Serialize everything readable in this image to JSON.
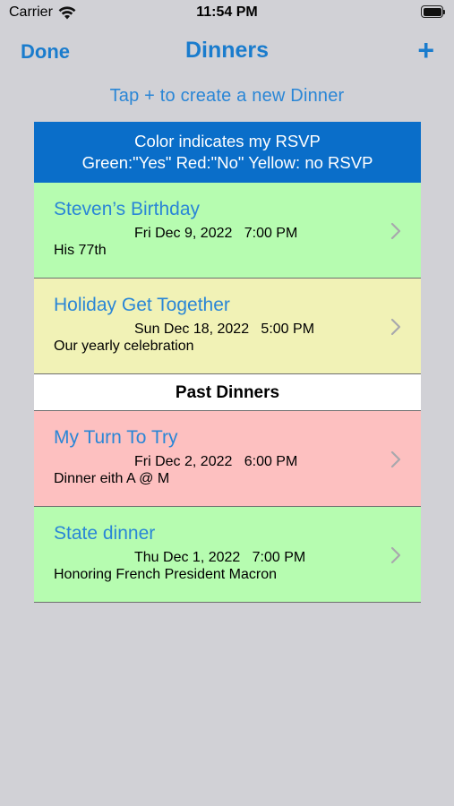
{
  "status_bar": {
    "carrier": "Carrier",
    "time": "11:54 PM",
    "wifi_icon": "wifi-icon",
    "battery_icon": "battery-icon"
  },
  "nav": {
    "done_label": "Done",
    "title": "Dinners",
    "add_label": "+"
  },
  "hint": "Tap  +  to create a new Dinner",
  "legend": {
    "line1": "Color indicates my RSVP",
    "line2": "Green:\"Yes\"  Red:\"No\"  Yellow: no RSVP"
  },
  "colors": {
    "accent": "#1a7ccd",
    "legend_bg": "#0a6ec9",
    "rsvp_yes": "#b6fcb0",
    "rsvp_no": "#fdc0c0",
    "rsvp_none": "#f1f2b6",
    "background": "#d1d1d6"
  },
  "upcoming": [
    {
      "title": "Steven’s Birthday",
      "datetime": "Fri Dec 9, 2022   7:00 PM",
      "description": "His 77th",
      "rsvp": "yes"
    },
    {
      "title": "Holiday Get Together",
      "datetime": "Sun Dec 18, 2022   5:00 PM",
      "description": "Our yearly celebration",
      "rsvp": "none"
    }
  ],
  "past_header": "Past Dinners",
  "past": [
    {
      "title": "My Turn To Try",
      "datetime": "Fri Dec 2, 2022   6:00 PM",
      "description": "Dinner eith A @ M",
      "rsvp": "no"
    },
    {
      "title": "State dinner",
      "datetime": "Thu Dec 1, 2022   7:00 PM",
      "description": "Honoring French President Macron",
      "rsvp": "yes"
    }
  ],
  "row_icon": "chevron-right-icon"
}
